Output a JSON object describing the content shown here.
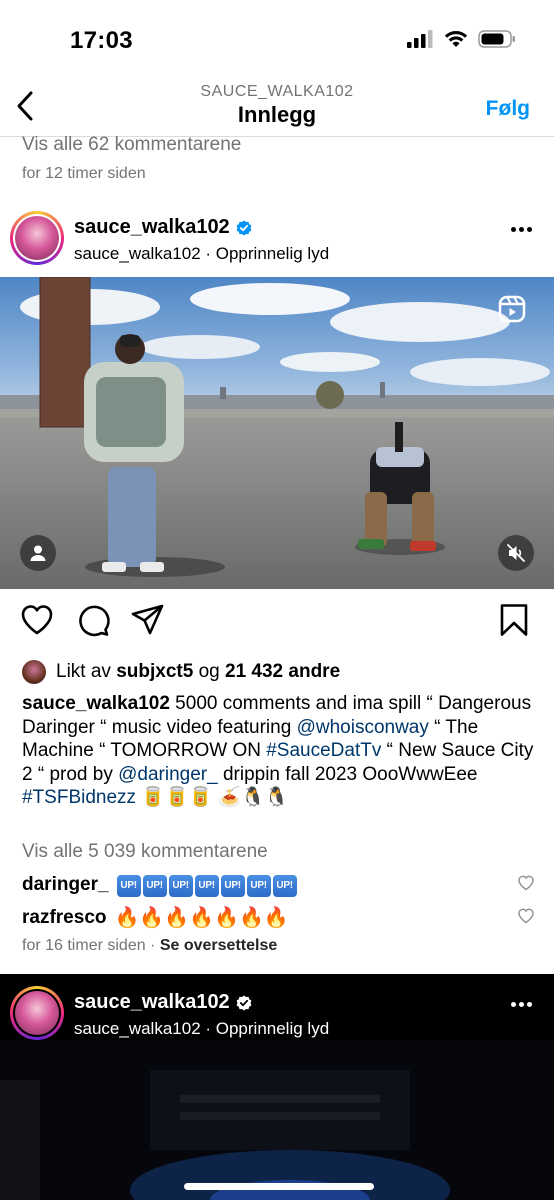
{
  "status_bar": {
    "time": "17:03"
  },
  "nav": {
    "username": "SAUCE_WALKA102",
    "title": "Innlegg",
    "follow_label": "Følg"
  },
  "previous_post": {
    "view_all_comments": "Vis alle 62 kommentarene",
    "time": "for 12 timer siden"
  },
  "post": {
    "username": "sauce_walka102",
    "audio": "sauce_walka102 · Opprinnelig lyd",
    "likes": {
      "prefix": "Likt av ",
      "user": "subjxct5",
      "joiner": " og ",
      "count": "21 432 andre"
    },
    "caption": {
      "username": "sauce_walka102",
      "part1": " 5000 comments and ima spill “ Dangerous Daringer “ music video featuring ",
      "mention1": "@whoisconway",
      "part2": " “ The Machine “ TOMORROW ON ",
      "hashtag1": "#SauceDatTv",
      "part3": " “ New Sauce City 2 “ prod by ",
      "mention2": "@daringer_",
      "part4": " drippin fall 2023 OooWwwEee ",
      "hashtag2": "#TSFBidnezz",
      "emoji_tail": " 🥫🥫🥫 🍝🐧🐧"
    },
    "view_all_comments": "Vis alle 5 039 kommentarene",
    "comments": [
      {
        "user": "daringer_",
        "badges": [
          "UP!",
          "UP!",
          "UP!",
          "UP!",
          "UP!",
          "UP!",
          "UP!"
        ]
      },
      {
        "user": "razfresco",
        "text": "🔥🔥🔥🔥🔥🔥🔥"
      }
    ],
    "time": "for 16 timer siden",
    "translate": "Se oversettelse"
  },
  "next_post": {
    "username": "sauce_walka102",
    "audio": "sauce_walka102 · Opprinnelig lyd"
  },
  "icons": {
    "back": "chevron-left-icon",
    "verified": "verified-badge-icon",
    "more": "more-horizontal-icon",
    "reels": "reels-icon",
    "tagged_user": "user-icon",
    "muted": "speaker-muted-icon",
    "like": "heart-icon",
    "comment": "comment-icon",
    "share": "send-icon",
    "save": "bookmark-icon"
  },
  "colors": {
    "link": "#00376b",
    "accent": "#0095f6",
    "verified": "#0095f6",
    "muted_text": "#737373"
  }
}
